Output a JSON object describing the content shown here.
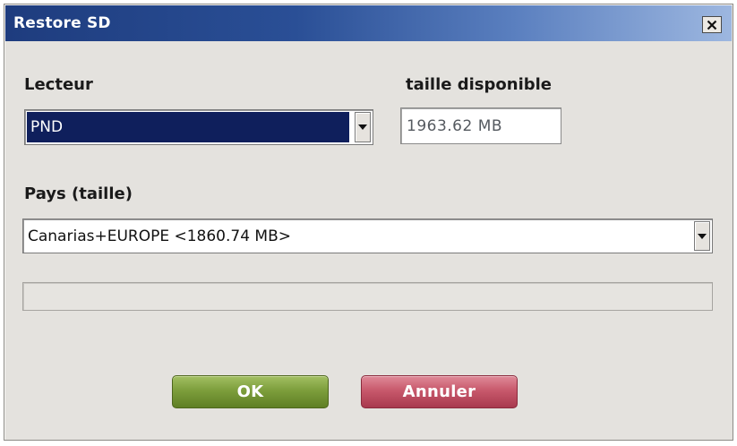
{
  "window": {
    "title": "Restore SD"
  },
  "lecteur": {
    "label": "Lecteur",
    "selected": "PND"
  },
  "taille": {
    "label": "taille disponible",
    "value": "1963.62 MB"
  },
  "pays": {
    "label": "Pays (taille)",
    "selected": "Canarias+EUROPE <1860.74 MB>"
  },
  "progress": {
    "value": 0
  },
  "buttons": {
    "ok": "OK",
    "cancel": "Annuler"
  },
  "icons": {
    "close": "close-icon",
    "dropdown": "chevron-down-icon"
  },
  "colors": {
    "titlebar": "#1e3c7e",
    "ok": "#7d9e3c",
    "cancel": "#c8596c",
    "selection": "#0f1f5c"
  }
}
